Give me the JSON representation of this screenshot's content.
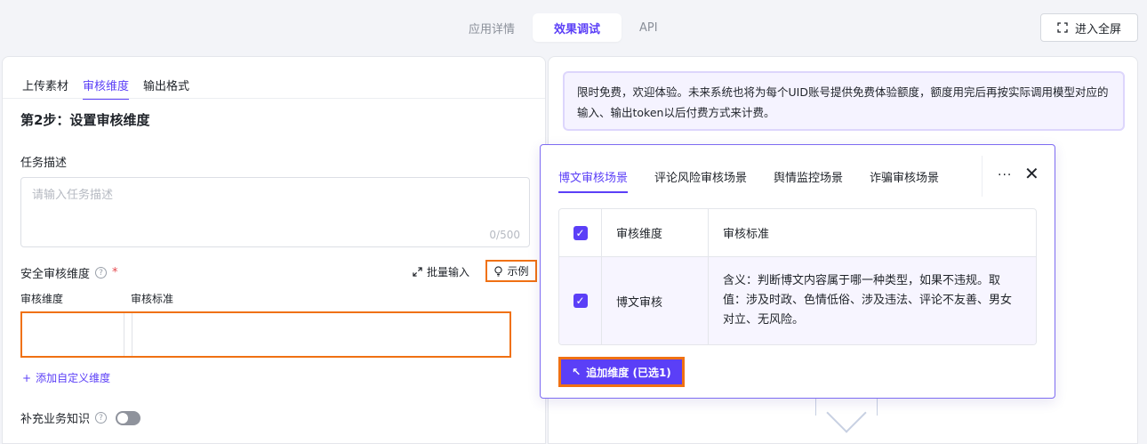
{
  "top_tabs": [
    "应用详情",
    "效果调试",
    "API"
  ],
  "fullscreen_label": "进入全屏",
  "left": {
    "sub_tabs": [
      "上传素材",
      "审核维度",
      "输出格式"
    ],
    "step_title": "第2步：设置审核维度",
    "task_label": "任务描述",
    "task_placeholder": "请输入任务描述",
    "task_count": "0/500",
    "security_label": "安全审核维度",
    "required_mark": "*",
    "batch_label": "批量输入",
    "example_label": "示例",
    "col_dimension": "审核维度",
    "col_standard": "审核标准",
    "add_custom": "添加自定义维度",
    "knowledge_label": "补充业务知识"
  },
  "notice": "限时免费，欢迎体验。未来系统也将为每个UID账号提供免费体验额度，额度用完后再按实际调用模型对应的输入、输出token以后付费方式来计费。",
  "popup": {
    "tabs": [
      "博文审核场景",
      "评论风险审核场景",
      "舆情监控场景",
      "诈骗审核场景"
    ],
    "header_dimension": "审核维度",
    "header_standard": "审核标准",
    "row_dimension": "博文审核",
    "row_standard": "含义：判断博文内容属于哪一种类型，如果不违规。取值：涉及时政、色情低俗、涉及违法、评论不友善、男女对立、无风险。",
    "add_button": "追加维度 (已选1)"
  },
  "colors": {
    "accent": "#5b3ff7",
    "highlight": "#f07113"
  }
}
